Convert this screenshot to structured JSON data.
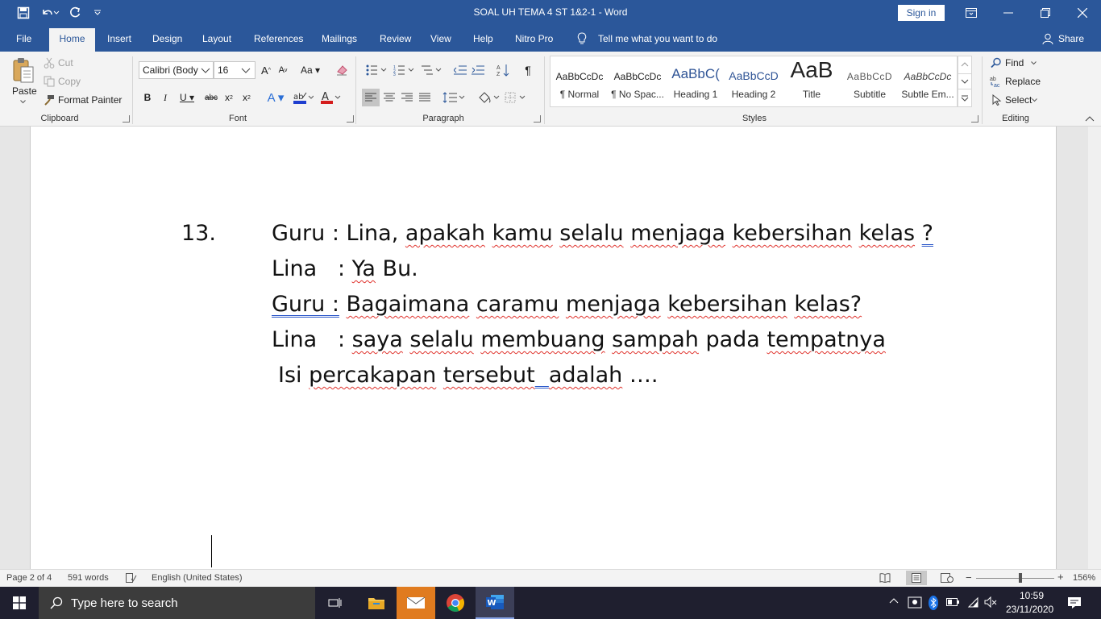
{
  "titlebar": {
    "doc_title": "SOAL UH TEMA 4 ST 1&2-1  -  Word",
    "sign_in": "Sign in"
  },
  "tabs": {
    "file": "File",
    "home": "Home",
    "insert": "Insert",
    "design": "Design",
    "layout": "Layout",
    "references": "References",
    "mailings": "Mailings",
    "review": "Review",
    "view": "View",
    "help": "Help",
    "nitro": "Nitro Pro",
    "tell_me": "Tell me what you want to do",
    "share": "Share"
  },
  "ribbon": {
    "clipboard": {
      "paste": "Paste",
      "cut": "Cut",
      "copy": "Copy",
      "format_painter": "Format Painter",
      "label": "Clipboard"
    },
    "font": {
      "font_name": "Calibri (Body",
      "font_size": "16",
      "label": "Font"
    },
    "paragraph": {
      "label": "Paragraph"
    },
    "styles": {
      "label": "Styles",
      "items": [
        {
          "preview": "AaBbCcDc",
          "name": "¶ Normal"
        },
        {
          "preview": "AaBbCcDc",
          "name": "¶ No Spac..."
        },
        {
          "preview": "AaBbC(",
          "name": "Heading 1"
        },
        {
          "preview": "AaBbCcD",
          "name": "Heading 2"
        },
        {
          "preview": "AaB",
          "name": "Title"
        },
        {
          "preview": "AaBbCcD",
          "name": "Subtitle"
        },
        {
          "preview": "AaBbCcDc",
          "name": "Subtle Em..."
        }
      ]
    },
    "editing": {
      "find": "Find",
      "replace": "Replace",
      "select": "Select",
      "label": "Editing"
    }
  },
  "document": {
    "number": "13.",
    "line1": {
      "speaker": "Guru : ",
      "w1": "Lina,",
      "w2": "apakah",
      "w3": "kamu",
      "w4": "selalu",
      "w5": "menjaga",
      "w6": "kebersihan",
      "w7": "kelas",
      "w8": "?"
    },
    "line2": {
      "speaker": "Lina   : ",
      "w1": "Ya",
      "w2": " Bu."
    },
    "line3": {
      "speaker": "Guru :",
      "w1": "Bagaimana",
      "w2": "caramu",
      "w3": "menjaga",
      "w4": "kebersihan",
      "w5": "kelas?"
    },
    "line4": {
      "speaker": "Lina   : ",
      "w1": "saya",
      "w2": "selalu",
      "w3": "membuang",
      "w4": "sampah",
      "w5": "pada",
      "w6": "tempatnya"
    },
    "line5": {
      "w0": "Isi ",
      "w1": "percakapan",
      "w2": "tersebut",
      "w3": "  ",
      "w4": "adalah",
      "w5": " …."
    }
  },
  "statusbar": {
    "page": "Page 2 of 4",
    "words": "591 words",
    "language": "English (United States)",
    "zoom": "156%"
  },
  "taskbar": {
    "search_placeholder": "Type here to search",
    "time": "10:59",
    "date": "23/11/2020"
  },
  "colors": {
    "word_blue": "#2b579a",
    "ribbon_bg": "#f3f3f3",
    "spell_red": "#e0322c",
    "grammar_blue": "#2b57c9"
  }
}
